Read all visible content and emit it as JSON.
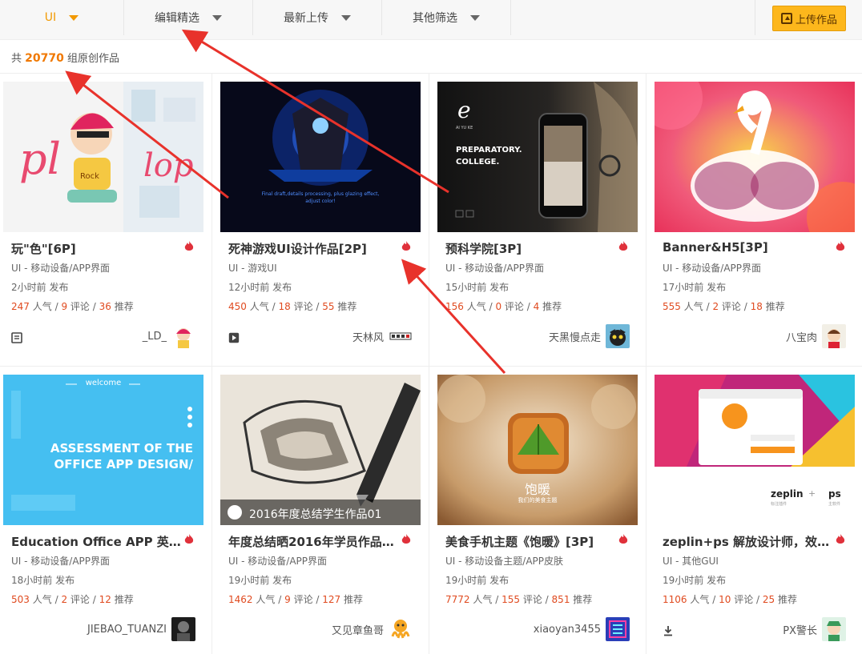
{
  "filters": [
    {
      "label": "UI",
      "active": true
    },
    {
      "label": "编辑精选",
      "active": false
    },
    {
      "label": "最新上传",
      "active": false
    },
    {
      "label": "其他筛选",
      "active": false
    }
  ],
  "upload_label": "上传作品",
  "count": {
    "prefix": "共",
    "value": "20770",
    "suffix": "组原创作品"
  },
  "units": {
    "popularity": "人气",
    "comments": "评论",
    "recommends": "推荐",
    "sep": "/"
  },
  "cards": [
    {
      "title": "玩\"色\"[6P]",
      "category": "UI - 移动设备/APP界面",
      "time": "2小时前 发布",
      "popularity": "247",
      "comments": "9",
      "recommends": "36",
      "author": "_LD_",
      "tool_icon": "document-icon"
    },
    {
      "title": "死神游戏UI设计作品[2P]",
      "category": "UI - 游戏UI",
      "time": "12小时前 发布",
      "popularity": "450",
      "comments": "18",
      "recommends": "55",
      "author": "天林风",
      "tool_icon": "play-icon",
      "thumb_caption": "Final draft,details processing, plus glazing effect, adjust color!"
    },
    {
      "title": "预科学院[3P]",
      "category": "UI - 移动设备/APP界面",
      "time": "15小时前 发布",
      "popularity": "156",
      "comments": "0",
      "recommends": "4",
      "author": "天黑慢点走",
      "thumb_heading": "PREPARATORY. COLLEGE.",
      "thumb_brand": "AI YU KE"
    },
    {
      "title": "Banner&H5[3P]",
      "category": "UI - 移动设备/APP界面",
      "time": "17小时前 发布",
      "popularity": "555",
      "comments": "2",
      "recommends": "18",
      "author": "八宝肉"
    },
    {
      "title": "Education Office APP 英文…",
      "category": "UI - 移动设备/APP界面",
      "time": "18小时前 发布",
      "popularity": "503",
      "comments": "2",
      "recommends": "12",
      "author": "JIEBAO_TUANZI",
      "thumb_top": "welcome",
      "thumb_text": "ASSESSMENT OF THE OFFICE APP DESIGN/"
    },
    {
      "title": "年度总结晒2016年学员作品0…",
      "category": "UI - 移动设备/APP界面",
      "time": "19小时前 发布",
      "popularity": "1462",
      "comments": "9",
      "recommends": "127",
      "author": "又见章鱼哥",
      "thumb_caption": "2016年度总结学生作品01"
    },
    {
      "title": "美食手机主题《饱暖》[3P]",
      "category": "UI - 移动设备主题/APP皮肤",
      "time": "19小时前 发布",
      "popularity": "7772",
      "comments": "155",
      "recommends": "851",
      "author": "xiaoyan3455",
      "thumb_title": "饱暖",
      "thumb_sub": "我们的美食主题"
    },
    {
      "title": "zeplin+ps 解放设计师，效率…",
      "category": "UI - 其他GUI",
      "time": "19小时前 发布",
      "popularity": "1106",
      "comments": "10",
      "recommends": "25",
      "author": "PX警长",
      "tool_icon": "download-icon",
      "thumb_left": "zeplin",
      "thumb_plus": "+",
      "thumb_right": "ps",
      "thumb_left_sub": "标注插件",
      "thumb_right_sub": "主软件"
    }
  ],
  "colors": {
    "accent": "#f29900",
    "stat_number": "#e04a1f",
    "upload_bg": "#fdb71c",
    "annotation_arrow": "#e8322b"
  }
}
